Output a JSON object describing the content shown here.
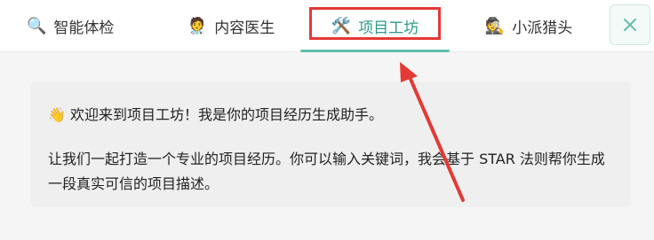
{
  "tabs": [
    {
      "label": "智能体检",
      "icon": "magnifier-icon",
      "emoji": "🔍",
      "active": false
    },
    {
      "label": "内容医生",
      "icon": "doctor-icon",
      "emoji": "🧑‍⚕️",
      "active": false
    },
    {
      "label": "项目工坊",
      "icon": "tools-icon",
      "emoji": "🛠️",
      "active": true
    },
    {
      "label": "小派猎头",
      "icon": "detective-icon",
      "emoji": "🕵️",
      "active": false
    }
  ],
  "close_icon": "×",
  "message": {
    "wave_emoji": "👋",
    "line1": "欢迎来到项目工坊！我是你的项目经历生成助手。",
    "line2": "让我们一起打造一个专业的项目经历。你可以输入关键词，我会基于 STAR 法则帮你生成一段真实可信的项目描述。"
  },
  "colors": {
    "accent": "#5fbfab",
    "annotation": "#e53935"
  }
}
